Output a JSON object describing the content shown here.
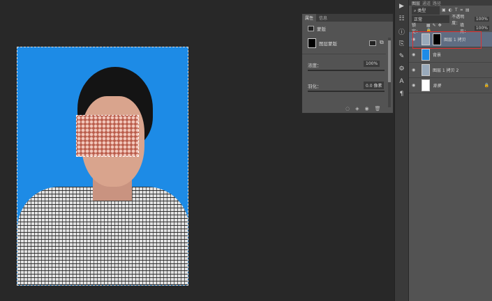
{
  "properties": {
    "tabs": [
      "属性",
      "信息"
    ],
    "type_label": "蒙版",
    "mask_label": "图层蒙版",
    "density_label": "浓度：",
    "density_value": "100%",
    "density": 100,
    "feather_label": "羽化：",
    "feather_value": "0.0 像素",
    "feather": 0
  },
  "layers_panel": {
    "tabs": [
      "图层",
      "通道",
      "路径"
    ],
    "filter": "类型",
    "blend_mode": "正常",
    "opacity_label": "不透明度：",
    "opacity": "100%",
    "lock_label": "锁定：",
    "fill_label": "填充：",
    "fill": "100%",
    "layers": [
      {
        "name": "图层 1 拷贝",
        "selected": true,
        "has_mask": true
      },
      {
        "name": "背景",
        "color": "#1d8be6"
      },
      {
        "name": "图层 1 拷贝 2"
      },
      {
        "name": "背景",
        "locked": true
      }
    ]
  },
  "tools": [
    "play-icon",
    "adjust-icon",
    "info-icon",
    "clone-source-icon",
    "brush-preset-icon",
    "settings-icon",
    "character-icon",
    "paragraph-icon"
  ],
  "colors": {
    "canvas_bg": "#1d8be6",
    "selection_highlight": "#e03030"
  }
}
